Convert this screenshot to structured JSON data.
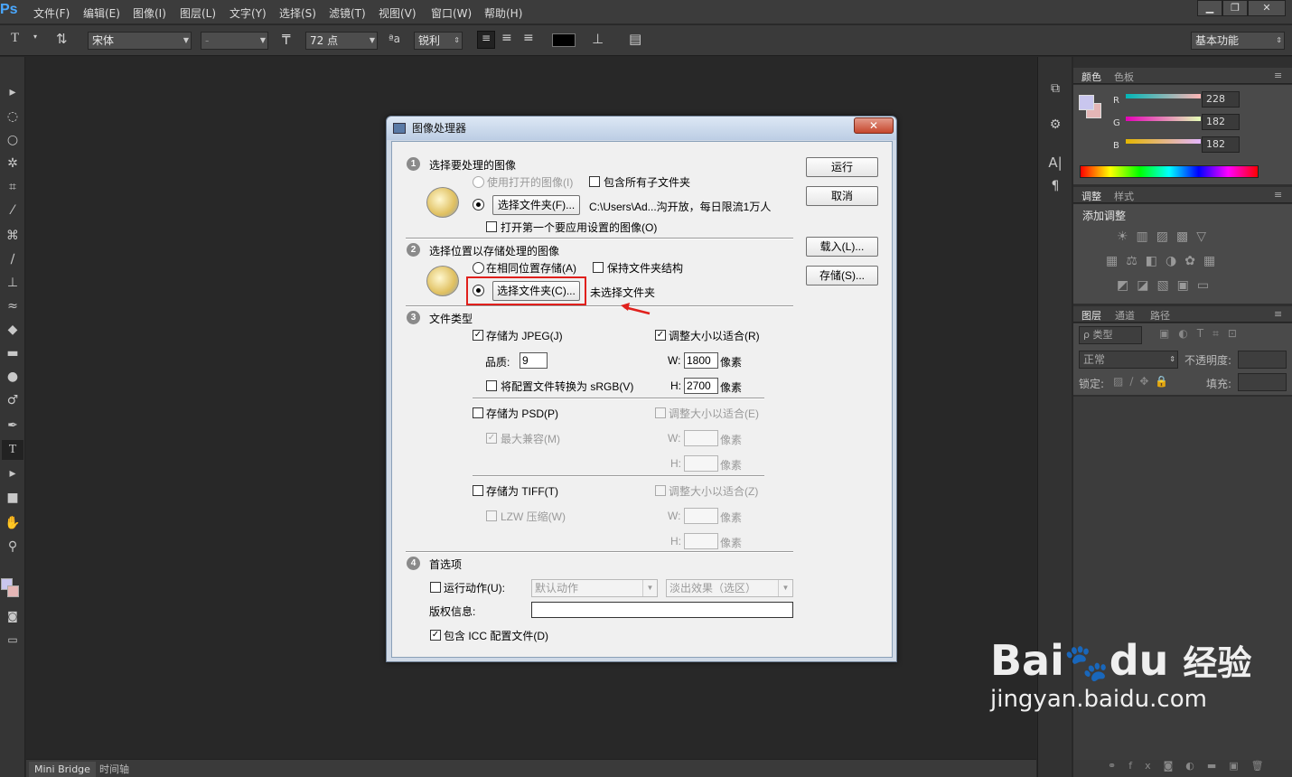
{
  "app": {
    "logo": "Ps"
  },
  "menu": [
    "文件(F)",
    "编辑(E)",
    "图像(I)",
    "图层(L)",
    "文字(Y)",
    "选择(S)",
    "滤镜(T)",
    "视图(V)",
    "窗口(W)",
    "帮助(H)"
  ],
  "window_controls": {
    "minimize": "▁",
    "restore": "❐",
    "close": "✕"
  },
  "options_bar": {
    "font_family": "宋体",
    "font_style": "-",
    "font_size": "72 点",
    "antialias": "锐利",
    "workspace": "基本功能",
    "color_swatch": "#000000"
  },
  "bottom_tabs": [
    "Mini Bridge",
    "时间轴"
  ],
  "panels": {
    "color": {
      "tabs": [
        "颜色",
        "色板"
      ],
      "r_label": "R",
      "g_label": "G",
      "b_label": "B",
      "r": "228",
      "g": "182",
      "b": "182",
      "foreground": "#c9c6ee",
      "background": "#e4b6b6"
    },
    "adjust": {
      "tabs": [
        "调整",
        "样式"
      ],
      "title": "添加调整"
    },
    "layers": {
      "tabs": [
        "图层",
        "通道",
        "路径"
      ],
      "filter": "ρ 类型",
      "blend": "正常",
      "opacity_label": "不透明度:",
      "lock_label": "锁定:",
      "fill_label": "填充:"
    }
  },
  "dialog": {
    "title": "图像处理器",
    "close": "✕",
    "section1": {
      "num": "1",
      "title": "选择要处理的图像",
      "use_open": "使用打开的图像(I)",
      "include_sub": "包含所有子文件夹",
      "choose_folder": "选择文件夹(F)...",
      "path": "C:\\Users\\Ad...沟开放，每日限流1万人",
      "open_first": "打开第一个要应用设置的图像(O)"
    },
    "section2": {
      "num": "2",
      "title": "选择位置以存储处理的图像",
      "same_loc": "在相同位置存储(A)",
      "keep_struct": "保持文件夹结构",
      "choose_folder": "选择文件夹(C)...",
      "no_folder": "未选择文件夹"
    },
    "section3": {
      "num": "3",
      "title": "文件类型",
      "jpeg": {
        "save": "存储为 JPEG(J)",
        "resize": "调整大小以适合(R)",
        "quality_label": "品质:",
        "quality": "9",
        "w_label": "W:",
        "w": "1800",
        "h_label": "H:",
        "h": "2700",
        "unit": "像素",
        "srgb": "将配置文件转换为 sRGB(V)"
      },
      "psd": {
        "save": "存储为 PSD(P)",
        "resize": "调整大小以适合(E)",
        "max_compat": "最大兼容(M)",
        "w_label": "W:",
        "h_label": "H:",
        "unit": "像素"
      },
      "tiff": {
        "save": "存储为 TIFF(T)",
        "resize": "调整大小以适合(Z)",
        "lzw": "LZW 压缩(W)",
        "w_label": "W:",
        "h_label": "H:",
        "unit": "像素"
      }
    },
    "section4": {
      "num": "4",
      "title": "首选项",
      "run_action": "运行动作(U):",
      "action_set": "默认动作",
      "action": "淡出效果（选区）",
      "copyright_label": "版权信息:",
      "copyright": "",
      "icc": "包含 ICC 配置文件(D)"
    },
    "buttons": {
      "run": "运行",
      "cancel": "取消",
      "load": "载入(L)...",
      "save": "存储(S)..."
    }
  },
  "watermark": {
    "brand": "Bai",
    "brand2": "du",
    "suffix": "经验",
    "url": "jingyan.baidu.com"
  }
}
